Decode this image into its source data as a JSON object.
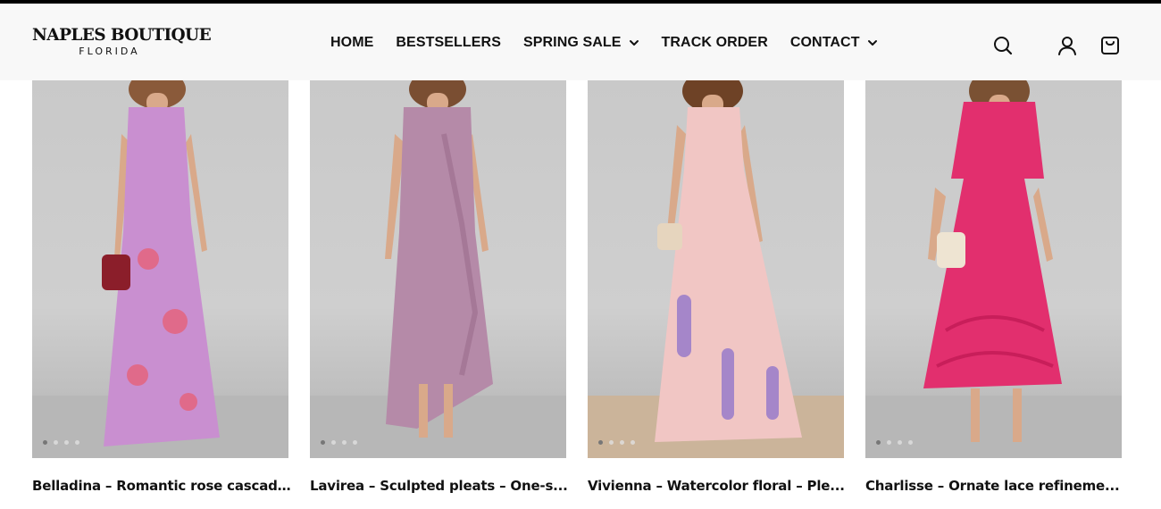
{
  "brand": {
    "name": "NAPLES BOUTIQUE",
    "location": "FLORIDA"
  },
  "nav": {
    "items": [
      {
        "label": "HOME",
        "has_dropdown": false
      },
      {
        "label": "BESTSELLERS",
        "has_dropdown": false
      },
      {
        "label": "SPRING SALE",
        "has_dropdown": true
      },
      {
        "label": "TRACK ORDER",
        "has_dropdown": false
      },
      {
        "label": "CONTACT",
        "has_dropdown": true
      }
    ]
  },
  "header_icons": [
    "search-icon",
    "account-icon",
    "cart-icon"
  ],
  "products": [
    {
      "title": "Belladina – Romantic rose cascad...",
      "dress_color": "#c98fd0",
      "accent_color": "#e06a8a",
      "slide_count": 4,
      "active_slide": 1
    },
    {
      "title": "Lavirea – Sculpted pleats – One-s...",
      "dress_color": "#b58aa8",
      "accent_color": "#a57897",
      "slide_count": 4,
      "active_slide": 1
    },
    {
      "title": "Vivienna – Watercolor floral – Ple...",
      "dress_color": "#f1c6c4",
      "accent_color": "#a586c9",
      "slide_count": 4,
      "active_slide": 1
    },
    {
      "title": "Charlisse – Ornate lace refineme...",
      "dress_color": "#e22f6e",
      "accent_color": "#c81e5a",
      "slide_count": 4,
      "active_slide": 1
    }
  ]
}
